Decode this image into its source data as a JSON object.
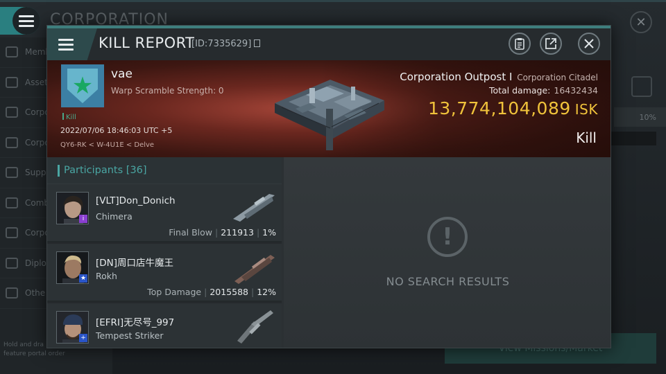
{
  "background": {
    "title": "CORPORATION",
    "sidebar_items": [
      {
        "label": "Memb",
        "icon": "members-icon"
      },
      {
        "label": "Asset",
        "icon": "assets-icon"
      },
      {
        "label": "Corpo",
        "icon": "chart-icon"
      },
      {
        "label": "Corpo",
        "icon": "pie-icon"
      },
      {
        "label": "Suppl",
        "icon": "supply-icon"
      },
      {
        "label": "Comb",
        "icon": "combat-icon"
      },
      {
        "label": "Corpo",
        "icon": "document-icon"
      },
      {
        "label": "Diplo",
        "icon": "diplomacy-icon"
      },
      {
        "label": "Othe",
        "icon": "other-icon"
      }
    ],
    "hint_line1": "Hold and dra",
    "hint_line2": "feature portal order",
    "percent": "10%",
    "mission_button": "View Missions/Market"
  },
  "dialog": {
    "title": "KILL REPORT",
    "report_id": "[ID:7335629]",
    "icons": [
      "clipboard-icon",
      "share-icon",
      "close-icon"
    ]
  },
  "victim": {
    "name": "vae",
    "warp_scramble": "Warp Scramble Strength: 0",
    "kill_tag": "Kill",
    "datetime": "2022/07/06 18:46:03 UTC +5",
    "location": "QY6-RK < W-4U1E < Delve"
  },
  "target": {
    "name": "Corporation Outpost I",
    "class": "Corporation Citadel",
    "total_damage_label": "Total damage:",
    "total_damage_value": "16432434",
    "isk_value": "13,774,104,089",
    "isk_unit": "ISK",
    "result": "Kill"
  },
  "participants": {
    "header": "Participants [36]",
    "rows": [
      {
        "name": "[VLT]Don_Donich",
        "ship": "Chimera",
        "label": "Final Blow",
        "damage": "211913",
        "percent": "1%",
        "badge_color": "#8a3fd0"
      },
      {
        "name": "[DN]周口店牛魔王",
        "ship": "Rokh",
        "label": "Top Damage",
        "damage": "2015588",
        "percent": "12%",
        "badge_color": "#2a55c8"
      },
      {
        "name": "[EFRI]无尽号_997",
        "ship": "Tempest Striker",
        "label": "",
        "damage": "",
        "percent": "",
        "badge_color": "#2a55c8"
      }
    ]
  },
  "empty_state": {
    "text": "NO SEARCH RESULTS"
  }
}
